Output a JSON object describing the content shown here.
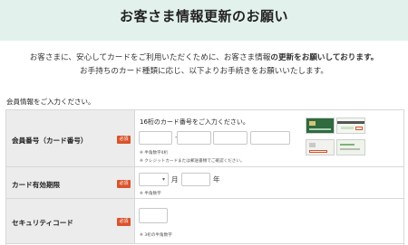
{
  "banner": {
    "title": "お客さま情報更新のお願い"
  },
  "intro": {
    "line1_pre": "お客さまに、安心してカードをご利用いただくために、お客さま情報",
    "line1_post": "の更新をお願いしております。",
    "line2": "お手持ちのカード種類に応じ、以下よりお手続きをお願いいたします。"
  },
  "section": {
    "label": "会員情報をご入力ください。"
  },
  "required_badge": "必須",
  "card_number": {
    "label": "会員番号（カード番号）",
    "hint": "16桁のカード番号をご入力ください。",
    "separator": "-",
    "note1": "※ 半角数字4桁",
    "note2": "※ クレジットカードまたは郵送書類でご確認ください。"
  },
  "expiry": {
    "label": "カード有効期限",
    "month_unit": "月",
    "year_unit": "年",
    "note": "※ 半角数字"
  },
  "security": {
    "label": "セキュリティコード",
    "note": "※ 3桁の半角数字"
  },
  "colors": {
    "banner_bg": "#e3f1ed",
    "required": "#d9532b",
    "header_cell": "#ececec"
  }
}
